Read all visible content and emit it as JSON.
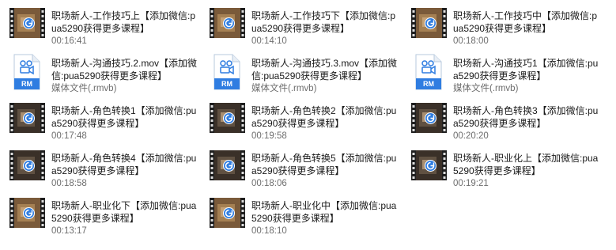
{
  "files": [
    {
      "name": "职场新人-工作技巧上【添加微信:pua5290获得更多课程】",
      "meta": "00:16:41",
      "type": "video",
      "thumb": "brown"
    },
    {
      "name": "职场新人-工作技巧下【添加微信:pua5290获得更多课程】",
      "meta": "00:14:10",
      "type": "video",
      "thumb": "brown"
    },
    {
      "name": "职场新人-工作技巧中【添加微信:pua5290获得更多课程】",
      "meta": "00:18:00",
      "type": "video",
      "thumb": "brown"
    },
    {
      "name": "职场新人-沟通技巧.2.mov【添加微信:pua5290获得更多课程】",
      "meta": "媒体文件(.rmvb)",
      "type": "rm",
      "label": "RM"
    },
    {
      "name": "职场新人-沟通技巧.3.mov【添加微信:pua5290获得更多课程】",
      "meta": "媒体文件(.rmvb)",
      "type": "rm",
      "label": "RM"
    },
    {
      "name": "职场新人-沟通技巧1【添加微信:pua5290获得更多课程】",
      "meta": "媒体文件(.rmvb)",
      "type": "rm",
      "label": "RM"
    },
    {
      "name": "职场新人-角色转换1【添加微信:pua5290获得更多课程】",
      "meta": "00:17:48",
      "type": "video",
      "thumb": "dark"
    },
    {
      "name": "职场新人-角色转换2【添加微信:pua5290获得更多课程】",
      "meta": "00:19:58",
      "type": "video",
      "thumb": "dark"
    },
    {
      "name": "职场新人-角色转换3【添加微信:pua5290获得更多课程】",
      "meta": "00:20:20",
      "type": "video",
      "thumb": "dark"
    },
    {
      "name": "职场新人-角色转换4【添加微信:pua5290获得更多课程】",
      "meta": "00:18:58",
      "type": "video",
      "thumb": "dark"
    },
    {
      "name": "职场新人-角色转换5【添加微信:pua5290获得更多课程】",
      "meta": "00:18:06",
      "type": "video",
      "thumb": "dark"
    },
    {
      "name": "职场新人-职业化上【添加微信:pua5290获得更多课程】",
      "meta": "00:19:21",
      "type": "video",
      "thumb": "dark"
    },
    {
      "name": "职场新人-职业化下【添加微信:pua5290获得更多课程】",
      "meta": "00:13:17",
      "type": "video",
      "thumb": "brown"
    },
    {
      "name": "职场新人-职业化中【添加微信:pua5290获得更多课程】",
      "meta": "00:18:10",
      "type": "video",
      "thumb": "brown"
    }
  ],
  "colors": {
    "rm_badge": "#2f7de1",
    "video_badge": "#2f7de1"
  }
}
